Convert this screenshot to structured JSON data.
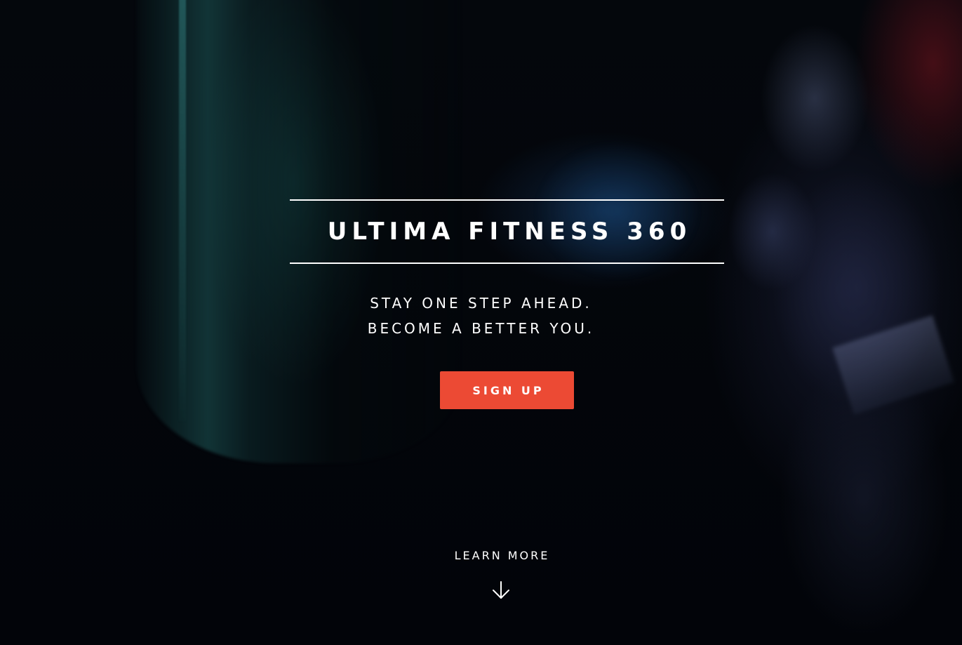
{
  "hero": {
    "title": "ULTIMA FITNESS 360",
    "tagline_line1": "STAY ONE STEP AHEAD.",
    "tagline_line2": "BECOME A BETTER YOU.",
    "signup_label": "SIGN UP",
    "learn_more_label": "LEARN MORE",
    "learn_more_icon": "arrow-down-icon"
  },
  "colors": {
    "accent": "#ec4a34",
    "text": "#ffffff",
    "background": "#020409"
  }
}
